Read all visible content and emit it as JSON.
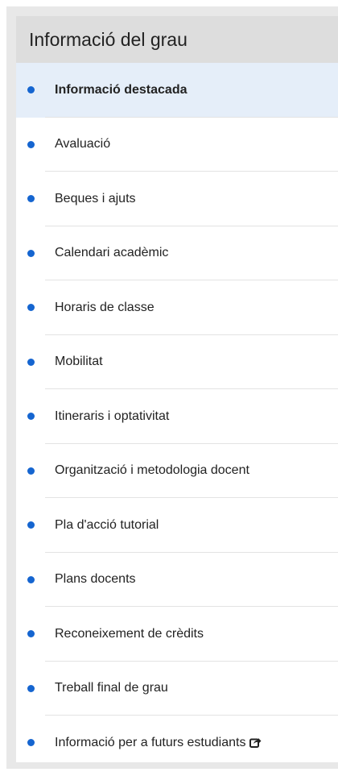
{
  "sidebar": {
    "title": "Informació del grau",
    "accent_color": "#1565d0",
    "active_bg": "#e5eef9",
    "items": [
      {
        "label": "Informació destacada",
        "active": true
      },
      {
        "label": "Avaluació"
      },
      {
        "label": "Beques i ajuts"
      },
      {
        "label": "Calendari acadèmic"
      },
      {
        "label": "Horaris de classe"
      },
      {
        "label": "Mobilitat"
      },
      {
        "label": "Itineraris i optativitat"
      },
      {
        "label": "Organització i metodologia docent"
      },
      {
        "label": "Pla d'acció tutorial"
      },
      {
        "label": "Plans docents"
      },
      {
        "label": "Reconeixement de crèdits"
      },
      {
        "label": "Treball final de grau"
      },
      {
        "label": "Informació per a futurs estudiants",
        "icon": "external-link-icon"
      }
    ]
  }
}
